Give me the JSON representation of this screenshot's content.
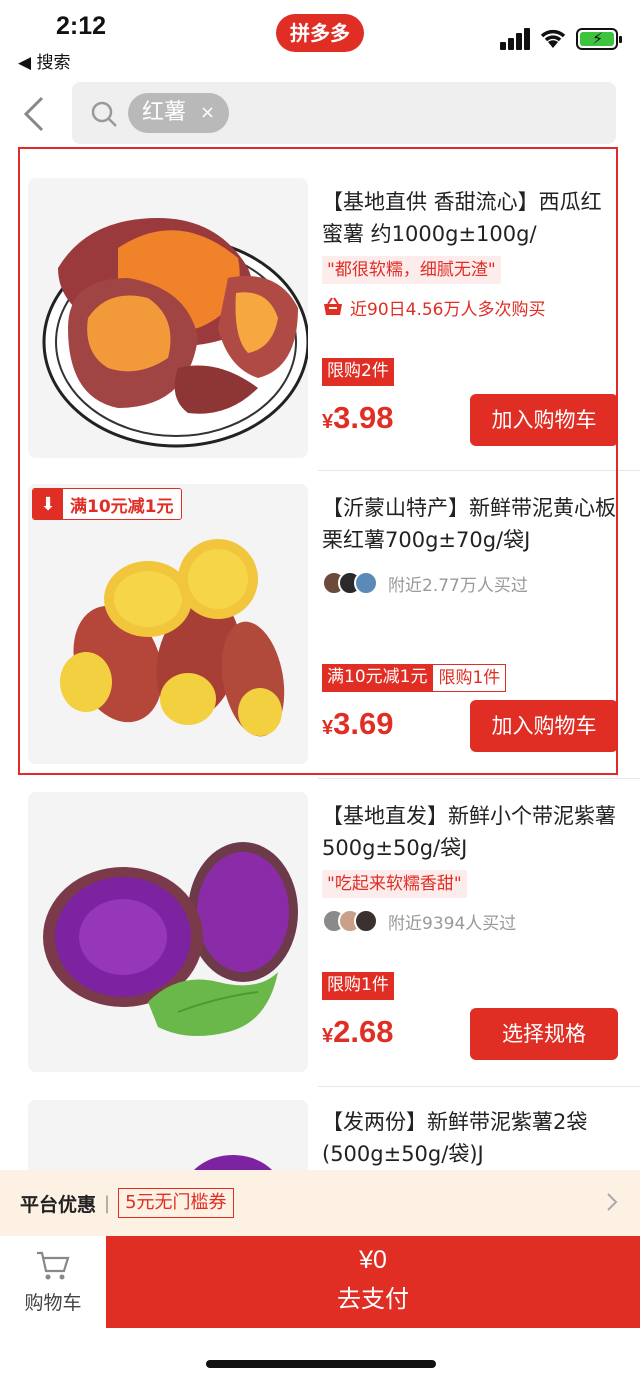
{
  "status_bar": {
    "time": "2:12",
    "back_app": "◀ 搜索",
    "logo": "拼多多"
  },
  "search": {
    "tag": "红薯",
    "clear": "×"
  },
  "products": [
    {
      "title": "【基地直供 香甜流心】西瓜红蜜薯 约1000g±100g/",
      "quote": "\"都很软糯，细腻无渣\"",
      "social": "近90日4.56万人多次购买",
      "badges": [
        "限购2件"
      ],
      "currency": "¥",
      "price": "3.98",
      "button": "加入购物车"
    },
    {
      "promo_corner": "满10元减1元",
      "title": "【沂蒙山特产】新鲜带泥黄心板栗红薯700g±70g/袋J",
      "social": "附近2.77万人买过",
      "badges": [
        "满10元减1元",
        "限购1件"
      ],
      "currency": "¥",
      "price": "3.69",
      "button": "加入购物车"
    },
    {
      "title": "【基地直发】新鲜小个带泥紫薯500g±50g/袋J",
      "quote": "\"吃起来软糯香甜\"",
      "social": "附近9394人买过",
      "badges": [
        "限购1件"
      ],
      "currency": "¥",
      "price": "2.68",
      "button": "选择规格"
    },
    {
      "title": "【发两份】新鲜带泥紫薯2袋(500g±50g/袋)J"
    }
  ],
  "coupon_bar": {
    "label": "平台优惠",
    "separator": "|",
    "coupon": "5元无门槛券"
  },
  "bottom_bar": {
    "cart_label": "购物车",
    "amount": "¥0",
    "pay_label": "去支付"
  },
  "colors": {
    "accent": "#e02e24",
    "coupon_bg": "#fdf1e3"
  }
}
